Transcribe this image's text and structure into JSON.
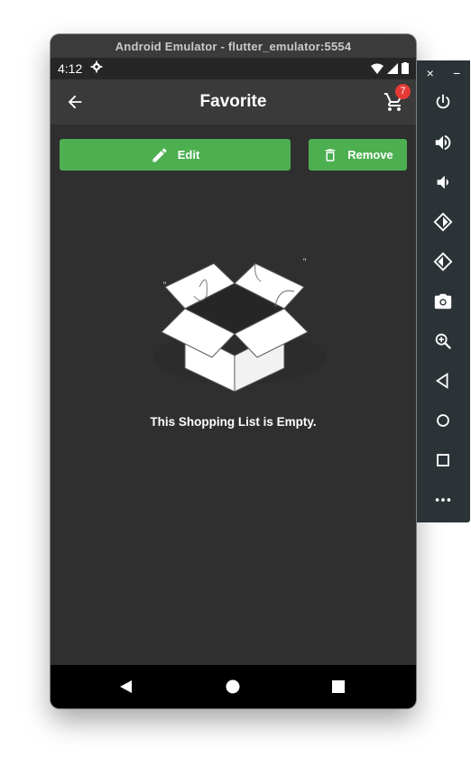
{
  "window": {
    "title": "Android Emulator - flutter_emulator:5554"
  },
  "status_bar": {
    "time": "4:12"
  },
  "app_bar": {
    "title": "Favorite",
    "cart_count": "7"
  },
  "actions": {
    "edit_label": "Edit",
    "remove_label": "Remove"
  },
  "empty_state": {
    "message": "This Shopping List is Empty."
  },
  "colors": {
    "accent": "#4caf50",
    "badge": "#e53935",
    "background": "#2f2f2f"
  },
  "side_toolbar": {
    "window_controls": [
      "×",
      "−"
    ],
    "icons": [
      "power-icon",
      "volume-up-icon",
      "volume-down-icon",
      "rotate-left-icon",
      "rotate-right-icon",
      "camera-icon",
      "zoom-icon",
      "back-icon",
      "home-icon",
      "overview-icon",
      "more-icon"
    ]
  }
}
